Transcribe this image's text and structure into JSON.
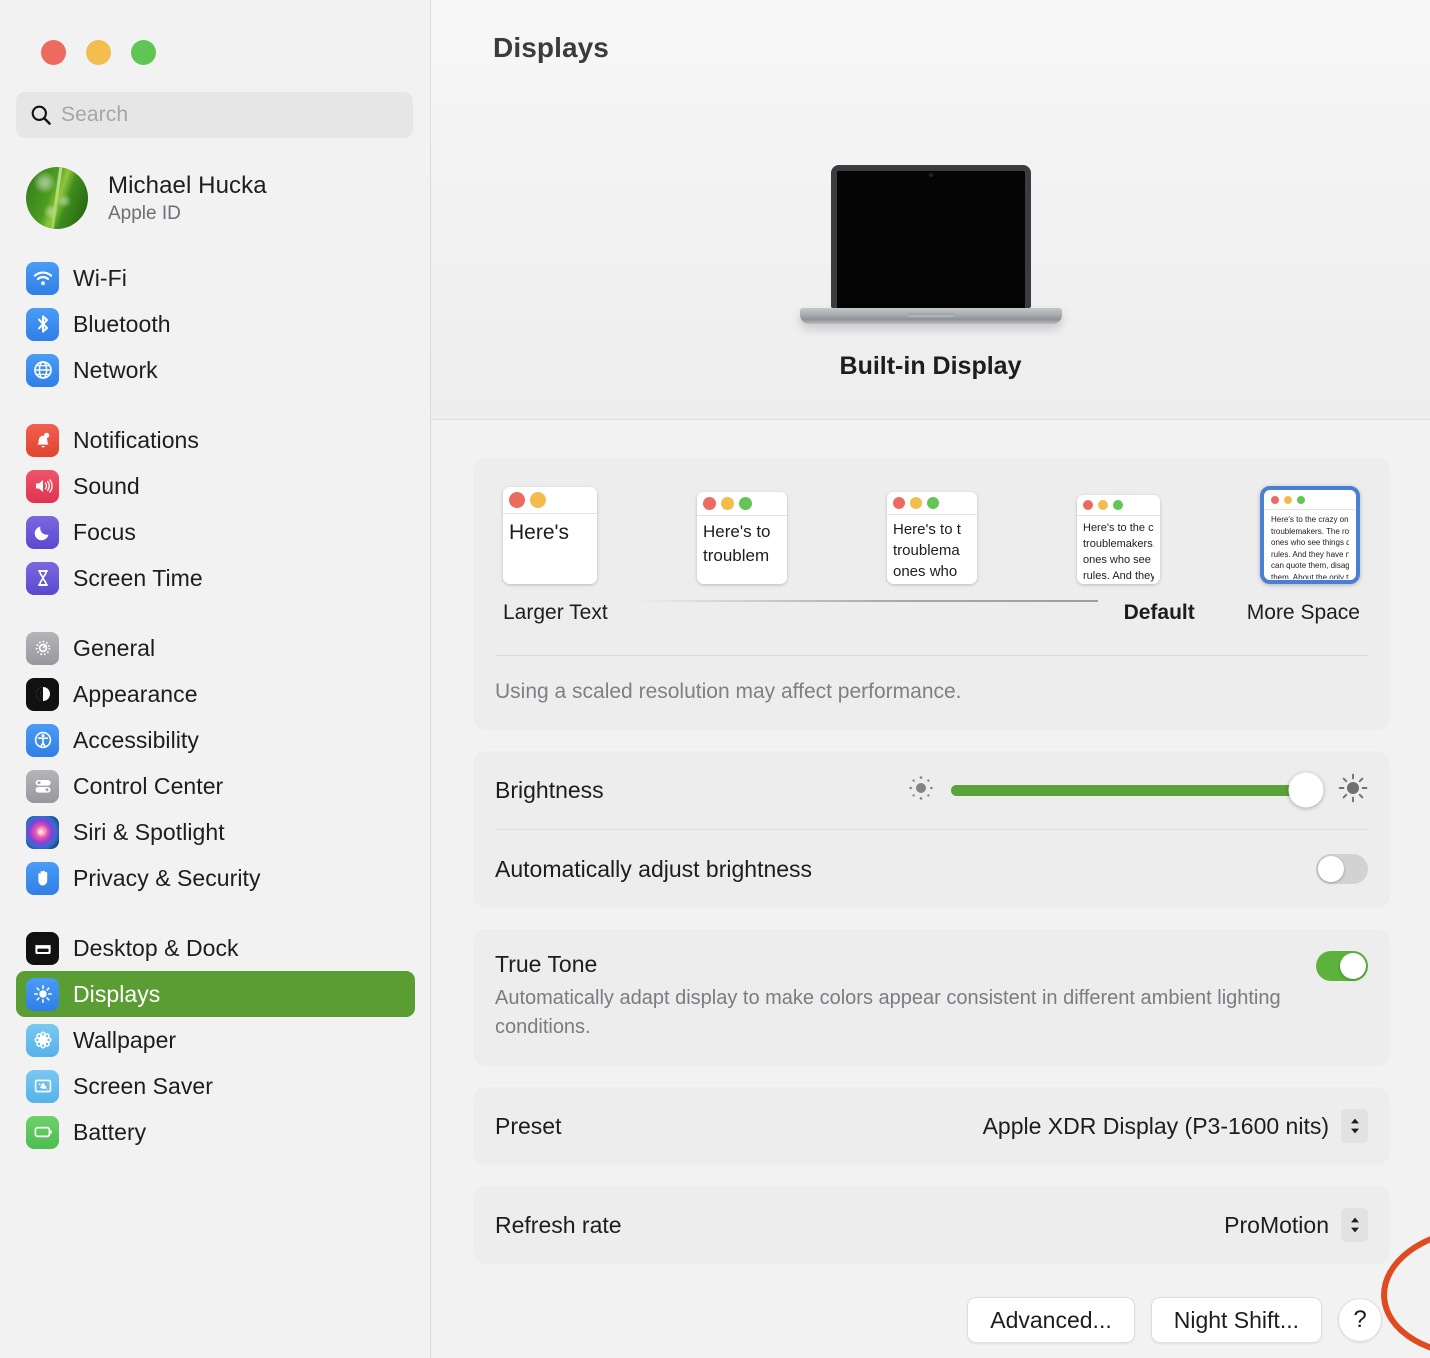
{
  "window": {
    "traffic_lights": [
      "close",
      "minimize",
      "zoom"
    ],
    "colors": {
      "close": "#ed6a5e",
      "minimize": "#f4bd4f",
      "zoom": "#61c554",
      "accent_green": "#5a9e33",
      "selection_blue": "#4a7fd4",
      "annotation_red": "#e04a21"
    }
  },
  "search": {
    "placeholder": "Search",
    "value": ""
  },
  "profile": {
    "name": "Michael Hucka",
    "subtitle": "Apple ID"
  },
  "sidebar": {
    "groups": [
      {
        "items": [
          {
            "label": "Wi-Fi",
            "icon": "wifi-icon"
          },
          {
            "label": "Bluetooth",
            "icon": "bluetooth-icon"
          },
          {
            "label": "Network",
            "icon": "network-globe-icon"
          }
        ]
      },
      {
        "items": [
          {
            "label": "Notifications",
            "icon": "bell-icon"
          },
          {
            "label": "Sound",
            "icon": "speaker-icon"
          },
          {
            "label": "Focus",
            "icon": "moon-icon"
          },
          {
            "label": "Screen Time",
            "icon": "hourglass-icon"
          }
        ]
      },
      {
        "items": [
          {
            "label": "General",
            "icon": "gear-icon"
          },
          {
            "label": "Appearance",
            "icon": "appearance-contrast-icon"
          },
          {
            "label": "Accessibility",
            "icon": "accessibility-icon"
          },
          {
            "label": "Control Center",
            "icon": "control-center-icon"
          },
          {
            "label": "Siri & Spotlight",
            "icon": "siri-icon"
          },
          {
            "label": "Privacy & Security",
            "icon": "hand-icon"
          }
        ]
      },
      {
        "items": [
          {
            "label": "Desktop & Dock",
            "icon": "desktop-dock-icon"
          },
          {
            "label": "Displays",
            "icon": "brightness-icon",
            "selected": true
          },
          {
            "label": "Wallpaper",
            "icon": "wallpaper-flower-icon"
          },
          {
            "label": "Screen Saver",
            "icon": "screen-saver-icon"
          },
          {
            "label": "Battery",
            "icon": "battery-icon"
          }
        ]
      }
    ]
  },
  "main": {
    "title": "Displays",
    "display_name": "Built-in Display",
    "resolution": {
      "options": [
        {
          "label": "Larger Text",
          "selected": false,
          "bold": false,
          "preview_text": "Here's"
        },
        {
          "label": "",
          "selected": false,
          "bold": false,
          "preview_text": "Here's to\ntroublem"
        },
        {
          "label": "",
          "selected": false,
          "bold": false,
          "preview_text": "Here's to t\ntroublema\nones who"
        },
        {
          "label": "Default",
          "selected": false,
          "bold": true,
          "preview_text": "Here's to the cr\ntroublemakers.\nones who see t\nrules. And they"
        },
        {
          "label": "More Space",
          "selected": true,
          "bold": false,
          "preview_text": "Here's to the crazy one\ntroublemakers. The rou\nones who see things dif\nrules. And they have no\ncan quote them, disagr\nthem. About the only th\nBecause they change th"
        }
      ],
      "note": "Using a scaled resolution may affect performance."
    },
    "brightness": {
      "label": "Brightness",
      "value_percent": 96
    },
    "auto_brightness": {
      "label": "Automatically adjust brightness",
      "enabled": false
    },
    "true_tone": {
      "label": "True Tone",
      "description": "Automatically adapt display to make colors appear consistent in different ambient lighting conditions.",
      "enabled": true
    },
    "preset": {
      "label": "Preset",
      "value": "Apple XDR Display (P3-1600 nits)"
    },
    "refresh_rate": {
      "label": "Refresh rate",
      "value": "ProMotion"
    },
    "buttons": {
      "advanced": "Advanced...",
      "night_shift": "Night Shift...",
      "help": "?"
    }
  }
}
